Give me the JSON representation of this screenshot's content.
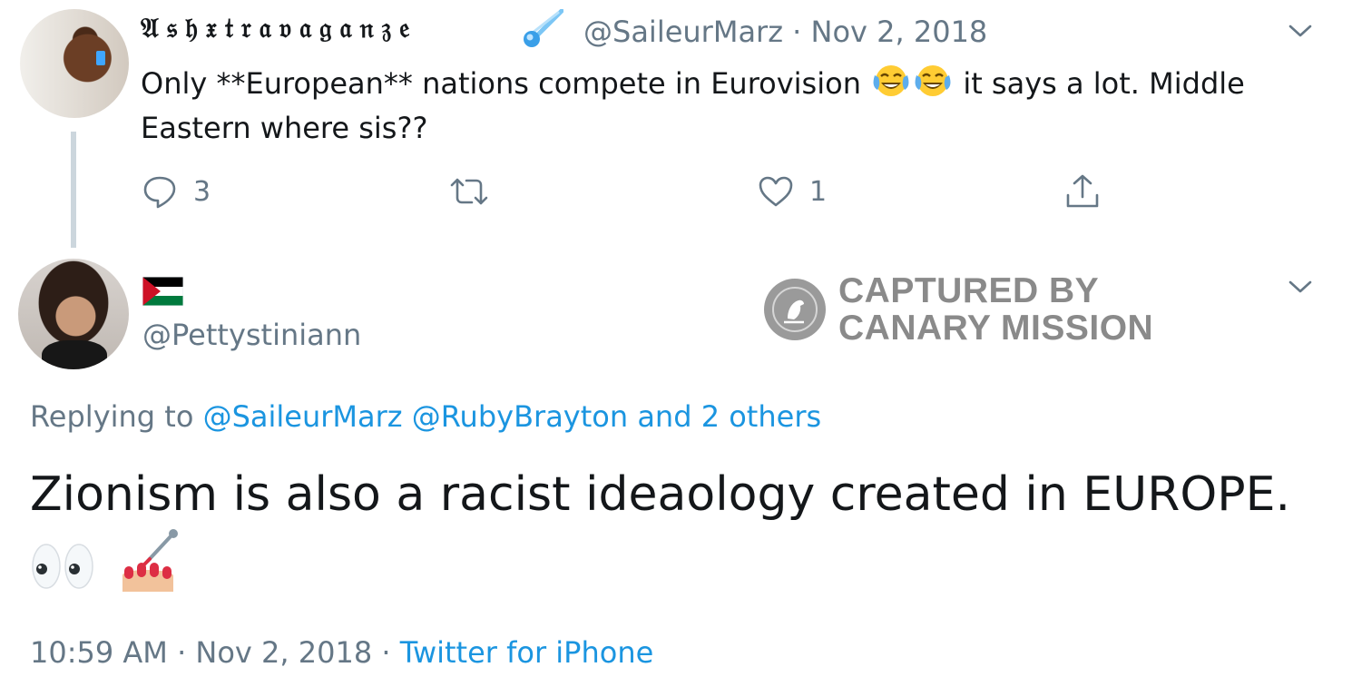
{
  "tweet1": {
    "display_name": "𝔄𝔰𝔥𝔵𝔱𝔯𝔞𝔳𝔞𝔤𝔞𝔫𝔷𝔢",
    "handle": "@SaileurMarz",
    "separator": "·",
    "date": "Nov 2, 2018",
    "text_before_emoji": "Only **European** nations compete in Eurovision",
    "text_after_emoji": "it says a lot. Middle Eastern where sis??",
    "emoji": [
      "face-with-tears-of-joy",
      "face-with-tears-of-joy"
    ],
    "reply_count": "3",
    "retweet_count": "",
    "like_count": "1"
  },
  "tweet2": {
    "handle": "@Pettystiniann",
    "replying_prefix": "Replying to",
    "replying_to": "@SaileurMarz @RubyBrayton and 2 others",
    "text": "Zionism is also a racist ideaology created in EUROPE.",
    "emoji": [
      "eyes",
      "nail-polish"
    ],
    "time": "10:59 AM",
    "separator": "·",
    "date": "Nov 2, 2018",
    "separator2": "·",
    "source": "Twitter for iPhone"
  },
  "watermark": {
    "line1": "CAPTURED BY",
    "line2": "CANARY MISSION"
  },
  "colors": {
    "text": "#14171a",
    "secondary": "#657786",
    "link": "#1b95e0",
    "thread_line": "#ccd6dd",
    "watermark": "#8a8a8a"
  },
  "icons": [
    "reply-icon",
    "retweet-icon",
    "like-icon",
    "share-icon",
    "chevron-down-icon",
    "palestine-flag-icon",
    "canary-logo-icon"
  ]
}
